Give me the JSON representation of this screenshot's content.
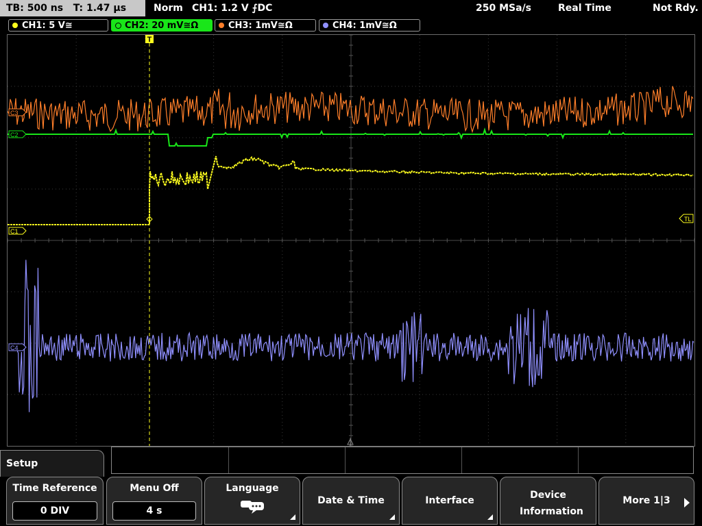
{
  "topbar": {
    "timebase": "TB: 500 ns",
    "trigger_time": "T: 1.47 µs",
    "mode": "Norm",
    "trigger_info": "CH1: 1.2 V ⨍DC",
    "sample_rate": "250 MSa/s",
    "acq_mode": "Real Time",
    "status": "Not Rdy."
  },
  "channels": [
    {
      "label": "CH1: 5 V≅",
      "color": "#ffff1e",
      "active": false
    },
    {
      "label": "CH2: 20 mV≅Ω",
      "color": "#19e619",
      "active": true
    },
    {
      "label": "CH3: 1mV≅Ω",
      "color": "#ff7f2a",
      "active": false
    },
    {
      "label": "CH4: 1mV≅Ω",
      "color": "#9090ff",
      "active": false
    }
  ],
  "markers": {
    "ch3": "C3",
    "ch2": "C2",
    "ch1": "C1",
    "ch4": "C4",
    "trigger_level": "TL",
    "trigger_pos": "T"
  },
  "menu": {
    "title": "Setup",
    "softkeys": [
      {
        "label": "Time Reference",
        "value": "0 DIV"
      },
      {
        "label": "Menu Off",
        "value": "4 s"
      },
      {
        "label": "Language",
        "icon": "speech-bubble-icon"
      },
      {
        "label": "Date & Time"
      },
      {
        "label": "Interface"
      },
      {
        "label": "Device Information"
      },
      {
        "label": "More 1|3"
      }
    ]
  }
}
